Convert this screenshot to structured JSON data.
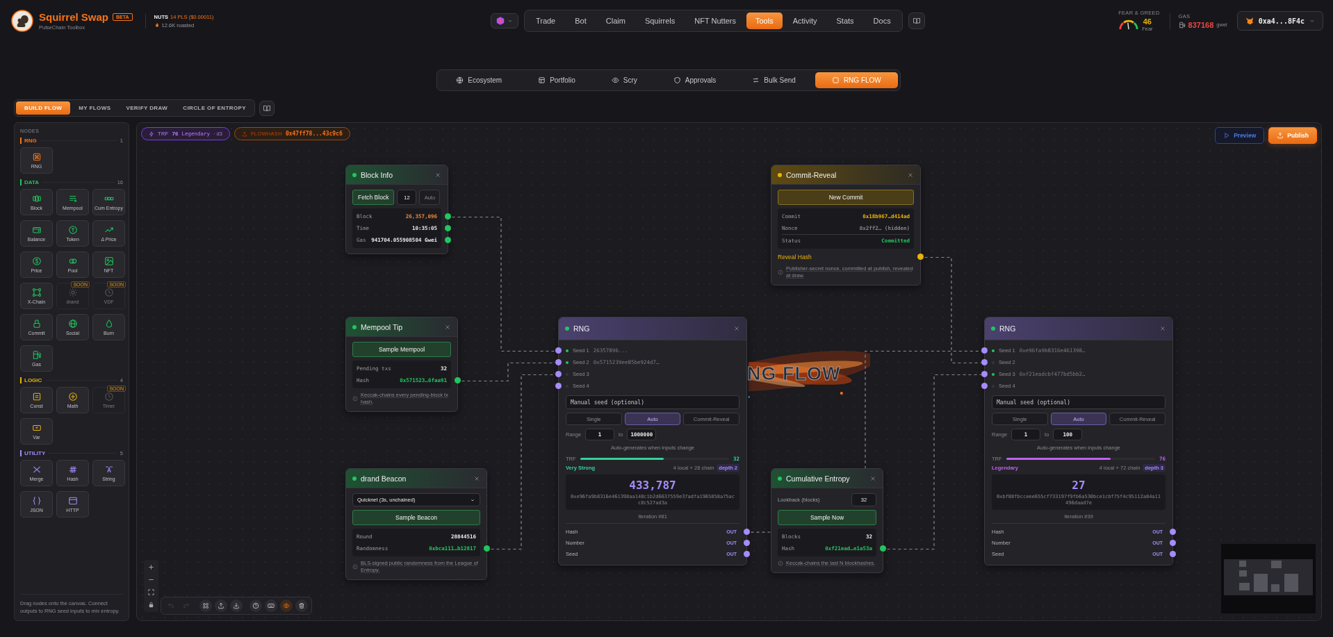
{
  "header": {
    "brand": {
      "name": "Squirrel Swap",
      "badge": "BETA",
      "subtitle": "PulseChain Toolbox"
    },
    "token": {
      "symbol": "NUTS",
      "price": "14 PLS ($0.00011)",
      "roasted": "12.6K roasted"
    },
    "nav": [
      {
        "label": "Trade",
        "selected": false
      },
      {
        "label": "Bot",
        "selected": false
      },
      {
        "label": "Claim",
        "selected": false
      },
      {
        "label": "Squirrels",
        "selected": false
      },
      {
        "label": "NFT Nutters",
        "selected": false
      },
      {
        "label": "Tools",
        "selected": true
      },
      {
        "label": "Activity",
        "selected": false
      },
      {
        "label": "Stats",
        "selected": false
      },
      {
        "label": "Docs",
        "selected": false
      }
    ],
    "fear_greed": {
      "label": "FEAR & GREED",
      "value": "46",
      "mood": "Fear",
      "level": 0.46
    },
    "gas": {
      "label": "GAS",
      "value": "837168",
      "unit": "gwei"
    },
    "wallet": {
      "address": "0xa4...8F4c"
    }
  },
  "subnav": [
    {
      "label": "Ecosystem",
      "selected": false
    },
    {
      "label": "Portfolio",
      "selected": false
    },
    {
      "label": "Scry",
      "selected": false
    },
    {
      "label": "Approvals",
      "selected": false
    },
    {
      "label": "Bulk Send",
      "selected": false
    },
    {
      "label": "RNG FLOW",
      "selected": true
    }
  ],
  "mode_tabs": [
    {
      "label": "BUILD FLOW",
      "selected": true
    },
    {
      "label": "MY FLOWS",
      "selected": false
    },
    {
      "label": "VERIFY DRAW",
      "selected": false
    },
    {
      "label": "CIRCLE OF ENTROPY",
      "selected": false
    }
  ],
  "sidebar": {
    "title": "NODES",
    "sections": [
      {
        "name": "RNG",
        "count": "1",
        "color": "#f97316",
        "items": [
          {
            "label": "RNG",
            "kind": "dice",
            "disabled": false
          }
        ]
      },
      {
        "name": "DATA",
        "count": "16",
        "color": "#22c55e",
        "items": [
          {
            "label": "Block",
            "kind": "blocks",
            "disabled": false
          },
          {
            "label": "Mempool",
            "kind": "list",
            "disabled": false
          },
          {
            "label": "Cum Entropy",
            "kind": "chain",
            "disabled": false
          },
          {
            "label": "Balance",
            "kind": "wallet",
            "disabled": false
          },
          {
            "label": "Token",
            "kind": "token",
            "disabled": false
          },
          {
            "label": "Δ Price",
            "kind": "trend",
            "disabled": false
          },
          {
            "label": "Price",
            "kind": "coin",
            "disabled": false
          },
          {
            "label": "Pool",
            "kind": "rings",
            "disabled": false
          },
          {
            "label": "NFT",
            "kind": "image",
            "disabled": false
          },
          {
            "label": "X-Chain",
            "kind": "network",
            "disabled": false
          },
          {
            "label": "drand",
            "kind": "sun",
            "disabled": true,
            "badge": "SOON"
          },
          {
            "label": "VDF",
            "kind": "clock",
            "disabled": true,
            "badge": "SOON"
          },
          {
            "label": "Commit",
            "kind": "lock",
            "disabled": false
          },
          {
            "label": "Social",
            "kind": "globe",
            "disabled": false
          },
          {
            "label": "Burn",
            "kind": "drop",
            "disabled": false
          },
          {
            "label": "Gas",
            "kind": "pump",
            "disabled": false
          }
        ]
      },
      {
        "name": "LOGIC",
        "count": "4",
        "color": "#eab308",
        "items": [
          {
            "label": "Const",
            "kind": "const",
            "disabled": false
          },
          {
            "label": "Math",
            "kind": "plus",
            "disabled": false
          },
          {
            "label": "Timer",
            "kind": "clock",
            "disabled": true,
            "badge": "SOON"
          },
          {
            "label": "Var",
            "kind": "var",
            "disabled": false
          }
        ]
      },
      {
        "name": "UTILITY",
        "count": "5",
        "color": "#a78bfa",
        "items": [
          {
            "label": "Merge",
            "kind": "merge",
            "disabled": false
          },
          {
            "label": "Hash",
            "kind": "hash",
            "disabled": false
          },
          {
            "label": "String",
            "kind": "quote",
            "disabled": false
          },
          {
            "label": "JSON",
            "kind": "braces",
            "disabled": false
          },
          {
            "label": "HTTP",
            "kind": "window",
            "disabled": false
          }
        ]
      }
    ],
    "hint": "Drag nodes onto the canvas. Connect outputs to RNG seed inputs to mix entropy."
  },
  "canvas": {
    "trf_badge": {
      "label": "TRF",
      "value": "76",
      "tier": "Legendary",
      "depth": "· d3"
    },
    "flowhash_badge": {
      "label": "FLOWHASH",
      "value": "0x47ff78...43c9c6"
    },
    "actions": [
      {
        "label": "Preview",
        "kind": "outline"
      },
      {
        "label": "Publish",
        "kind": "primary"
      }
    ],
    "art_title": "NG FLOW",
    "nodes": [
      {
        "kind": "block",
        "title": "Block Info",
        "button": "Fetch Block",
        "count": "12",
        "auto": {
          "label": "Auto",
          "on": false
        },
        "rows": [
          {
            "label": "Block",
            "value": "26,357,096",
            "color": "#f0883e",
            "port": true
          },
          {
            "label": "Time",
            "value": "10:35:05",
            "color": "#ececef",
            "port": true
          },
          {
            "label": "Gas",
            "value": "941704.055908504 Gwei",
            "color": "#ececef",
            "port": true
          }
        ]
      },
      {
        "kind": "commit",
        "title": "Commit-Reveal",
        "button": "New Commit",
        "rows": [
          {
            "label": "Commit",
            "value": "0x18b967…d414ad",
            "color": "#eab308",
            "port": false
          },
          {
            "label": "Nonce",
            "value": "0x2ff2… (hidden)",
            "color": "#85858c",
            "port": false
          },
          {
            "label": "Status",
            "value": "Committed",
            "color": "#22c55e",
            "port": false
          }
        ],
        "output": "Reveal Hash",
        "note": "Publisher-secret nonce, committed at publish, revealed at draw."
      },
      {
        "kind": "mempool",
        "title": "Mempool Tip",
        "button": "Sample Mempool",
        "rows": [
          {
            "label": "Pending txs",
            "value": "32",
            "color": "#ececef",
            "port": false
          },
          {
            "label": "Hash",
            "value": "0x571523…6faa91",
            "color": "#22c55e",
            "port": true
          }
        ],
        "note": "Keccak-chains every pending-block tx hash."
      },
      {
        "kind": "rng",
        "title": "RNG",
        "seeds": [
          {
            "label": "Seed 1",
            "value": "26357896...",
            "connected": true
          },
          {
            "label": "Seed 2",
            "value": "0x5715239ee85be924d7…",
            "connected": true
          },
          {
            "label": "Seed 3",
            "connected": false
          },
          {
            "label": "Seed 4",
            "connected": false
          }
        ],
        "manual_placeholder": "Manual seed (optional)",
        "modes": [
          {
            "label": "Single",
            "selected": false
          },
          {
            "label": "Auto",
            "selected": true
          },
          {
            "label": "Commit-Reveal",
            "selected": false
          }
        ],
        "range": {
          "label": "Range",
          "from": "1",
          "to_label": "to",
          "to": "1000000"
        },
        "auto_note": "Auto-generates when inputs change",
        "trf": {
          "label": "TRF",
          "level": 0.56,
          "value": "32",
          "tier": "Very Strong",
          "color": "#34d399",
          "sources": "4 local + 28 chain",
          "depth": "depth 2"
        },
        "result": "433,787",
        "hash": "0xe96fa9b8316e461398aa148c1b2d6637559e37adfa1965858a75acc8c527ad3a",
        "iteration": "Iteration #81",
        "outputs": [
          {
            "label": "Hash",
            "tag": "OUT"
          },
          {
            "label": "Number",
            "tag": "OUT"
          },
          {
            "label": "Seed",
            "tag": "OUT"
          }
        ]
      },
      {
        "kind": "rng",
        "title": "RNG",
        "seeds": [
          {
            "label": "Seed 1",
            "value": "0xe96fa9b8316e461398…",
            "connected": true
          },
          {
            "label": "Seed 2",
            "connected": false
          },
          {
            "label": "Seed 3",
            "value": "0xf21eadcbf477bd5bb2…",
            "connected": true
          },
          {
            "label": "Seed 4",
            "connected": false
          }
        ],
        "manual_placeholder": "Manual seed (optional)",
        "modes": [
          {
            "label": "Single",
            "selected": false
          },
          {
            "label": "Auto",
            "selected": true
          },
          {
            "label": "Commit-Reveal",
            "selected": false
          }
        ],
        "range": {
          "label": "Range",
          "from": "1",
          "to_label": "to",
          "to": "100"
        },
        "auto_note": "Auto-generates when inputs change",
        "trf": {
          "label": "TRF",
          "level": 0.7,
          "value": "76",
          "tier": "Legendary",
          "color": "#c061f0",
          "sources": "4 local + 72 chain",
          "depth": "depth 3"
        },
        "result": "27",
        "hash": "0xbf88fbcceee655cf733197f9fb6a530bce1cbf75f4c95112a84a11496daad7e",
        "iteration": "Iteration #39",
        "outputs": [
          {
            "label": "Hash",
            "tag": "OUT"
          },
          {
            "label": "Number",
            "tag": "OUT"
          },
          {
            "label": "Seed",
            "tag": "OUT"
          }
        ]
      },
      {
        "kind": "drand",
        "title": "drand Beacon",
        "select": "Quicknet (3s, unchained)",
        "button": "Sample Beacon",
        "rows": [
          {
            "label": "Round",
            "value": "28844516",
            "color": "#ececef",
            "port": false
          },
          {
            "label": "Randomness",
            "value": "0xbca111…b12817",
            "color": "#22c55e",
            "port": true
          }
        ],
        "note": "BLS-signed public randomness from the League of Entropy."
      },
      {
        "kind": "cumulative",
        "title": "Cumulative Entropy",
        "field": {
          "label": "Lookback (blocks)",
          "value": "32"
        },
        "button": "Sample Now",
        "rows": [
          {
            "label": "Blocks",
            "value": "32",
            "color": "#ececef",
            "port": false
          },
          {
            "label": "Hash",
            "value": "0xf21ead…e1a53a",
            "color": "#22c55e",
            "port": true
          }
        ],
        "note": "Keccak-chains the last N blockhashes."
      }
    ],
    "toolbar": [
      {
        "kind": "undo",
        "disabled": true,
        "on": false
      },
      {
        "kind": "redo",
        "disabled": true,
        "on": false
      },
      {
        "kind": "layout",
        "disabled": false,
        "on": false
      },
      {
        "kind": "export",
        "disabled": false,
        "on": false
      },
      {
        "kind": "import",
        "disabled": false,
        "on": false
      },
      {
        "kind": "help",
        "disabled": false,
        "on": false
      },
      {
        "kind": "keyboard",
        "disabled": false,
        "on": false
      },
      {
        "kind": "eye",
        "disabled": false,
        "on": true
      },
      {
        "kind": "trash",
        "disabled": false,
        "on": false
      }
    ]
  }
}
